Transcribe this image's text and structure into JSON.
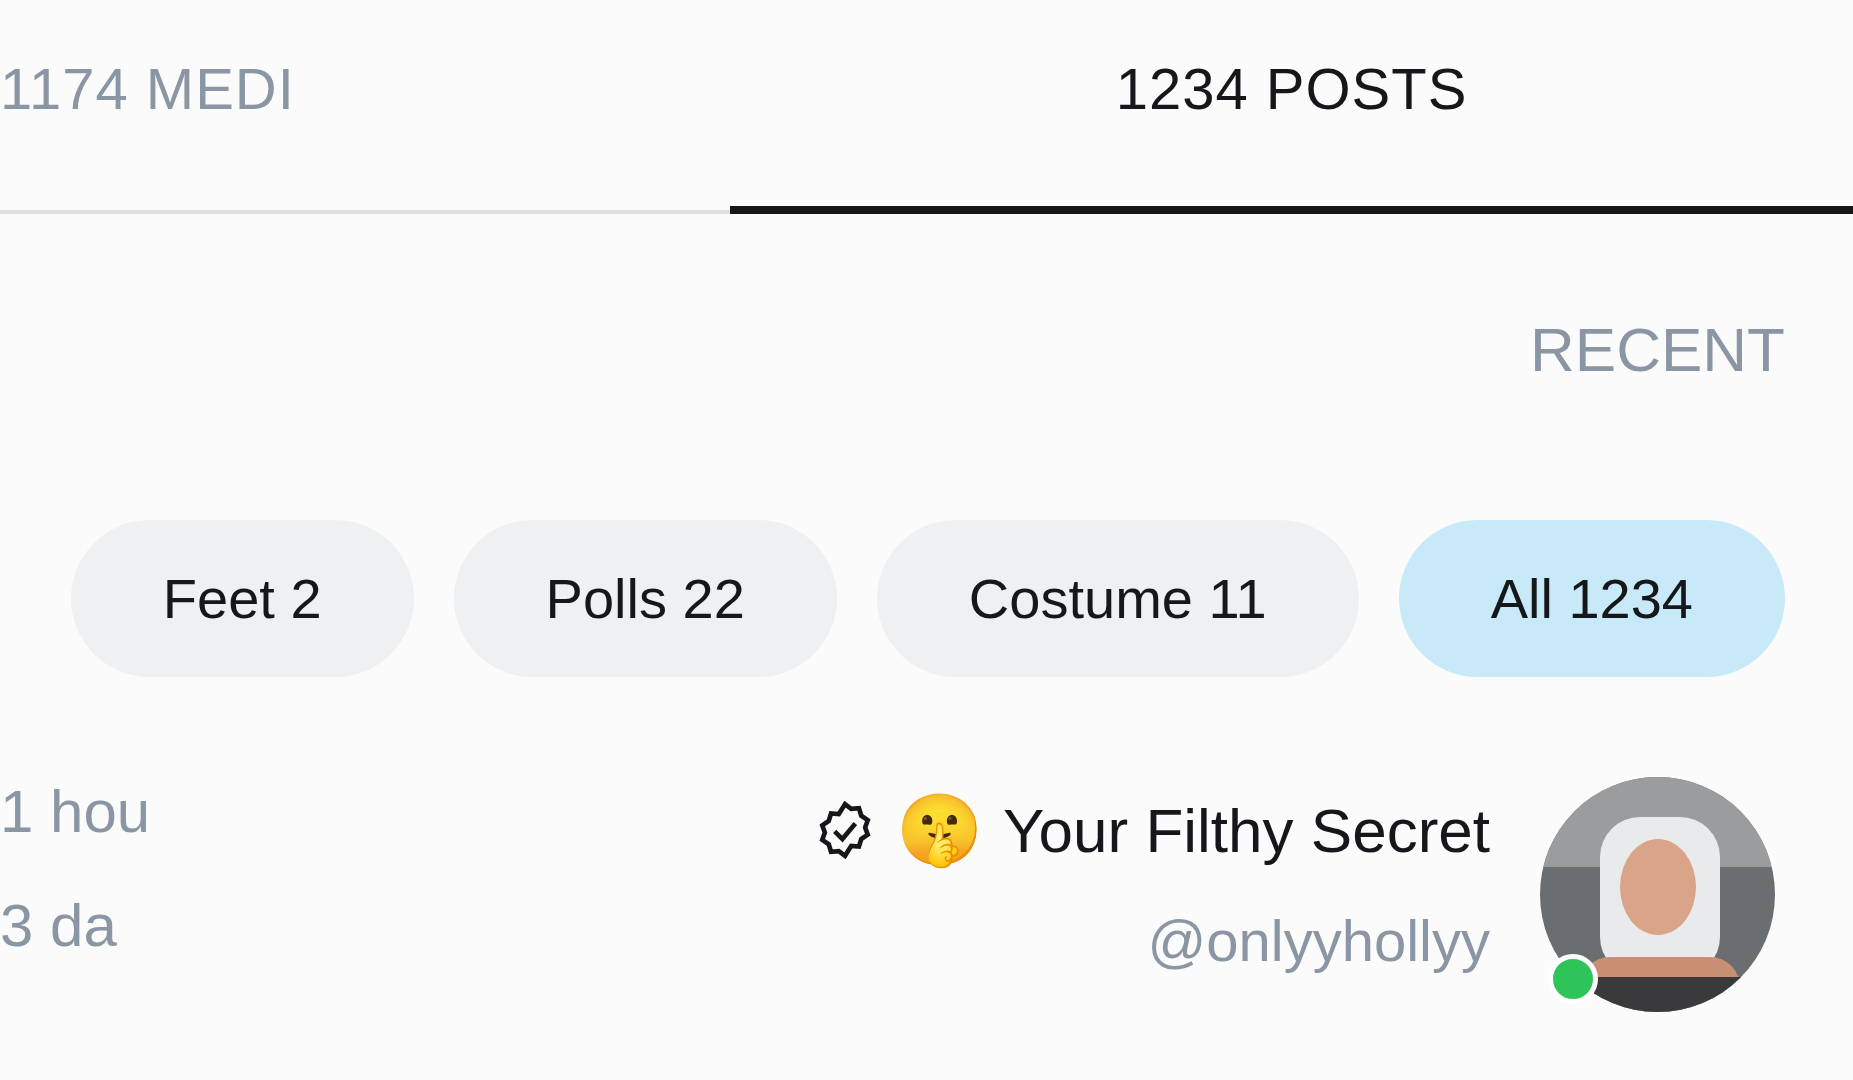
{
  "tabs": [
    {
      "label": "1174 MEDI",
      "selected": false
    },
    {
      "label": "1234 POSTS",
      "selected": true
    }
  ],
  "section_label": "RECENT",
  "filters": [
    {
      "label": "Feet 2",
      "selected": false
    },
    {
      "label": "Polls 22",
      "selected": false
    },
    {
      "label": "Costume 11",
      "selected": false
    },
    {
      "label": "All 1234",
      "selected": true
    }
  ],
  "post": {
    "name": "Your Filthy Secret",
    "emoji": "🤫",
    "verified": true,
    "handle": "@onlyyhollyy",
    "online": true,
    "time": "1 hou",
    "time_2": "3 da"
  }
}
